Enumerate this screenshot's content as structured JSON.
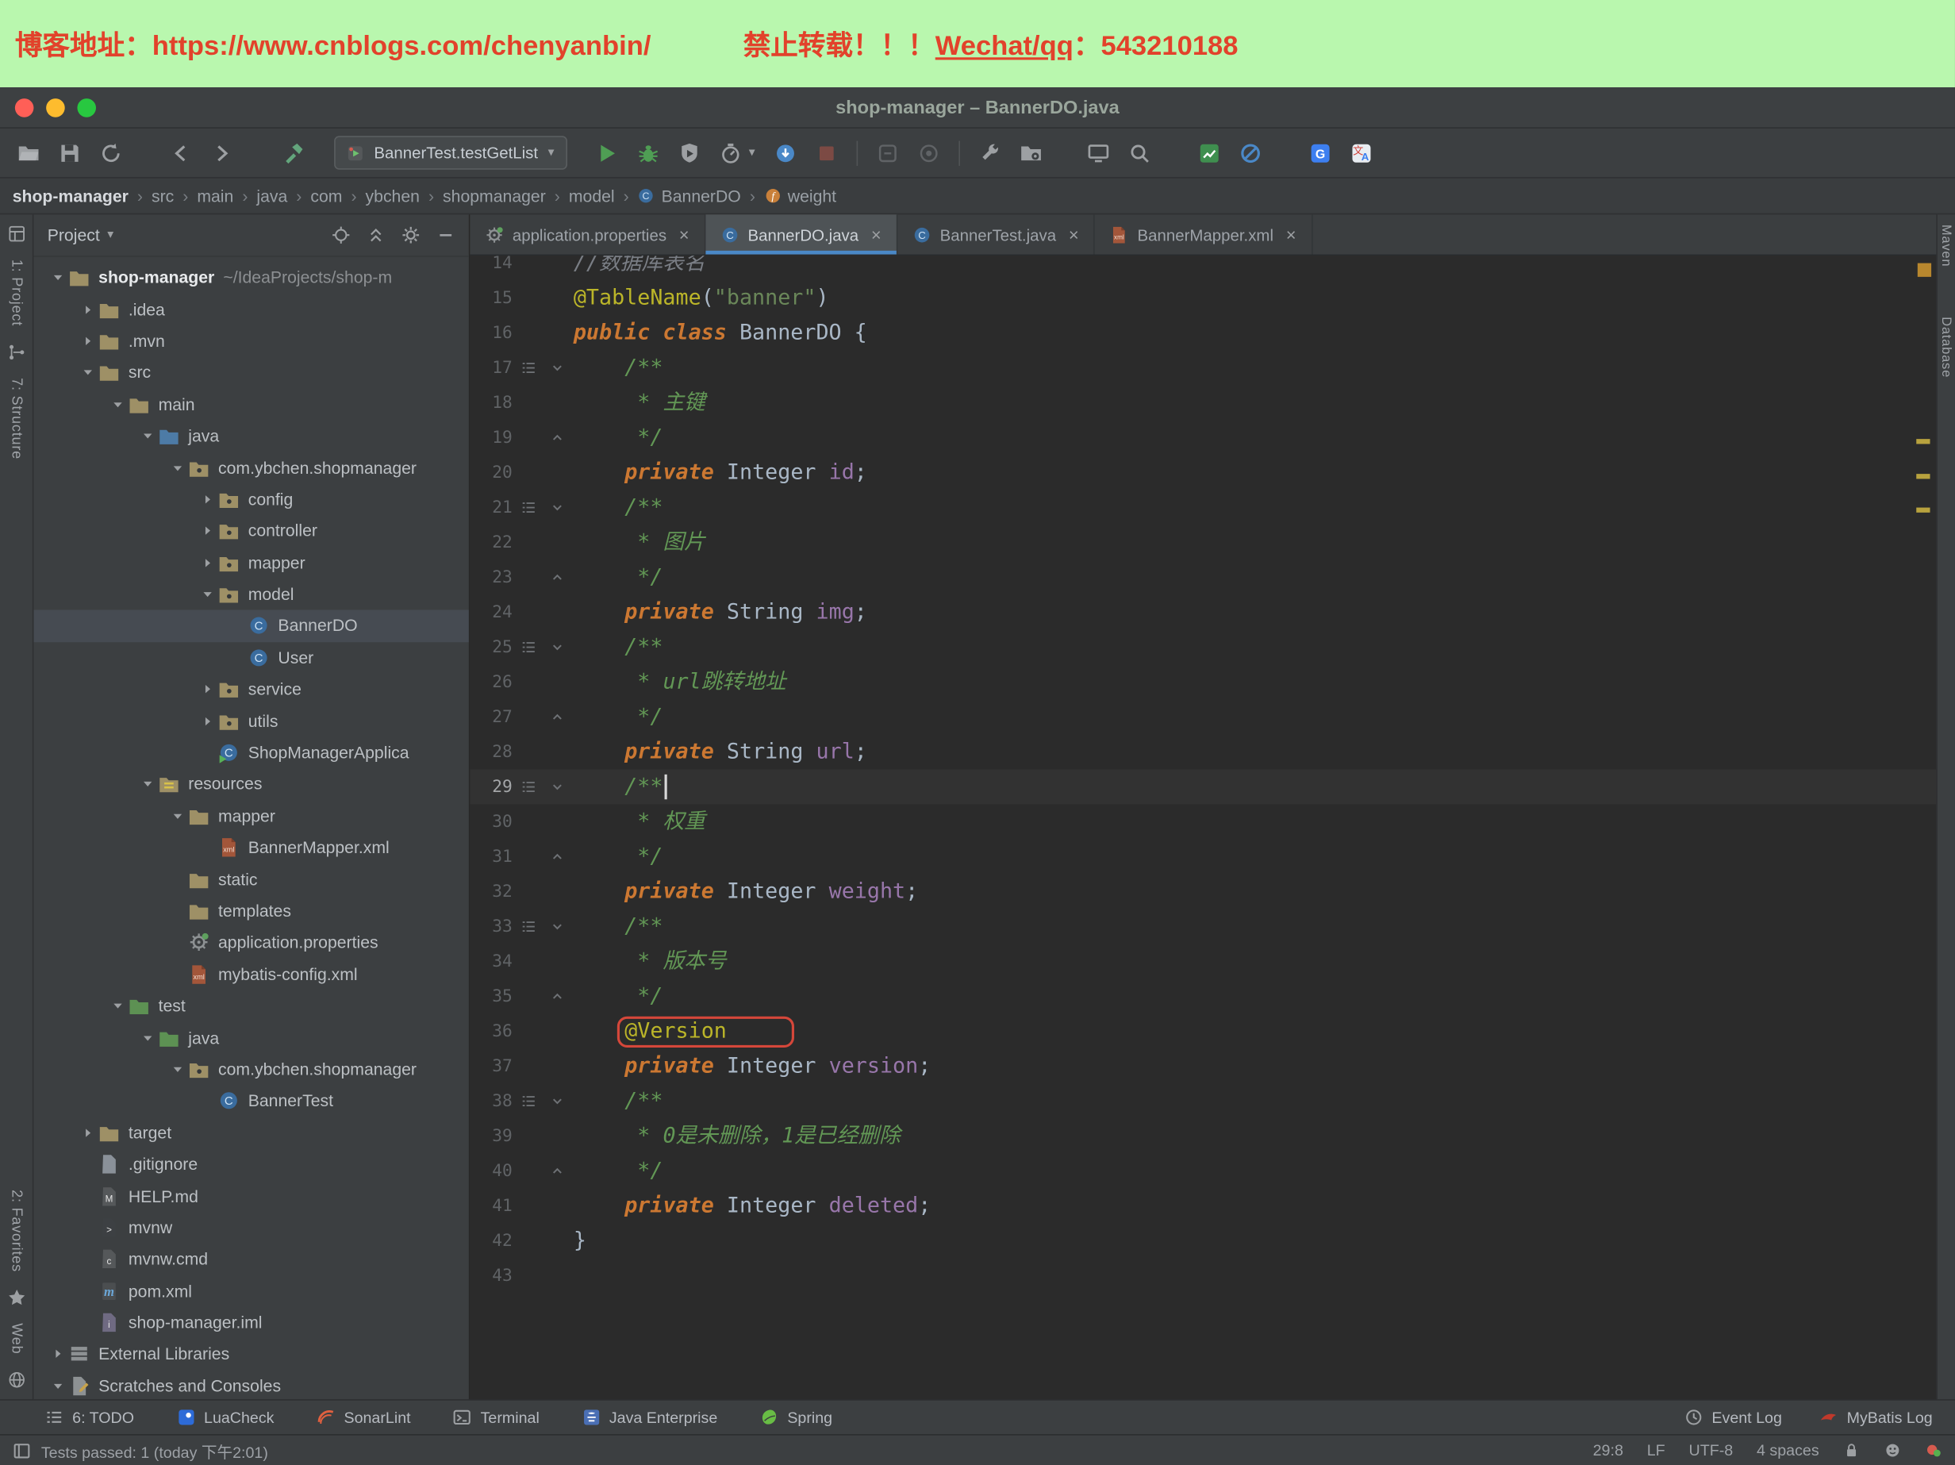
{
  "window": {
    "title": "shop-manager – BannerDO.java"
  },
  "banner": {
    "left": "博客地址：https://www.cnblogs.com/chenyanbin/",
    "right_prefix": "禁止转载！！！",
    "right_link": "Wechat/qq",
    "right_suffix": "：543210188"
  },
  "colors": {
    "banner_bg": "#b9f7ae",
    "banner_text": "#e2422b",
    "accent_blue": "#4a88c7",
    "annotation_highlight_box": "#d5473a",
    "run_green": "#4f9e54",
    "editor_bg": "#2b2b2b",
    "panel_bg": "#3c3f41"
  },
  "toolbar": {
    "run_config": "BannerTest.testGetList",
    "items": [
      {
        "icon": "open-folder-icon"
      },
      {
        "icon": "save-icon"
      },
      {
        "icon": "sync-icon"
      },
      {
        "gap": 8
      },
      {
        "icon": "back-icon"
      },
      {
        "icon": "forward-icon"
      },
      {
        "gap": 10
      },
      {
        "icon": "build-hammer-icon"
      },
      {
        "runconfig": true
      },
      {
        "icon": "run-icon"
      },
      {
        "icon": "debug-icon"
      },
      {
        "icon": "coverage-icon"
      },
      {
        "icon": "profiler-icon",
        "caret": true
      },
      {
        "icon": "attach-icon"
      },
      {
        "icon": "stop-icon"
      },
      {
        "sep": true
      },
      {
        "icon": "attach-debugger-icon"
      },
      {
        "icon": "snapshot-icon"
      },
      {
        "sep": true
      },
      {
        "icon": "wrench-icon"
      },
      {
        "icon": "project-structure-icon"
      },
      {
        "gap": 6
      },
      {
        "icon": "remote-monitor-icon"
      },
      {
        "icon": "search-icon"
      },
      {
        "gap": 8
      },
      {
        "icon": "chart-icon"
      },
      {
        "icon": "blocked-icon"
      },
      {
        "gap": 8
      },
      {
        "icon": "google-translate-icon"
      },
      {
        "icon": "translate-icon"
      }
    ]
  },
  "breadcrumbs": [
    {
      "label": "shop-manager",
      "bold": true
    },
    {
      "label": "src"
    },
    {
      "label": "main"
    },
    {
      "label": "java"
    },
    {
      "label": "com"
    },
    {
      "label": "ybchen"
    },
    {
      "label": "shopmanager"
    },
    {
      "label": "model"
    },
    {
      "label": "BannerDO",
      "icon": "class-icon"
    },
    {
      "label": "weight",
      "icon": "field-icon"
    }
  ],
  "project_panel": {
    "title": "Project",
    "header_icons": [
      "locate-icon",
      "collapse-all-icon",
      "settings-gear-icon",
      "hide-icon"
    ],
    "tree": [
      {
        "label": "shop-manager",
        "suffix": "~/IdeaProjects/shop-m",
        "depth": 0,
        "arrow": "down",
        "icon": "folder",
        "bold": true
      },
      {
        "label": ".idea",
        "depth": 1,
        "arrow": "right",
        "icon": "folder"
      },
      {
        "label": ".mvn",
        "depth": 1,
        "arrow": "right",
        "icon": "folder"
      },
      {
        "label": "src",
        "depth": 1,
        "arrow": "down",
        "icon": "folder"
      },
      {
        "label": "main",
        "depth": 2,
        "arrow": "down",
        "icon": "folder"
      },
      {
        "label": "java",
        "depth": 3,
        "arrow": "down",
        "icon": "folder",
        "color": "#4d7ba6"
      },
      {
        "label": "com.ybchen.shopmanager",
        "depth": 4,
        "arrow": "down",
        "icon": "package"
      },
      {
        "label": "config",
        "depth": 5,
        "arrow": "right",
        "icon": "package"
      },
      {
        "label": "controller",
        "depth": 5,
        "arrow": "right",
        "icon": "package"
      },
      {
        "label": "mapper",
        "depth": 5,
        "arrow": "right",
        "icon": "package"
      },
      {
        "label": "model",
        "depth": 5,
        "arrow": "down",
        "icon": "package"
      },
      {
        "label": "BannerDO",
        "depth": 6,
        "icon": "class",
        "selected": true
      },
      {
        "label": "User",
        "depth": 6,
        "icon": "class"
      },
      {
        "label": "service",
        "depth": 5,
        "arrow": "right",
        "icon": "package"
      },
      {
        "label": "utils",
        "depth": 5,
        "arrow": "right",
        "icon": "package"
      },
      {
        "label": "ShopManagerApplica",
        "depth": 5,
        "icon": "class-run"
      },
      {
        "label": "resources",
        "depth": 3,
        "arrow": "down",
        "icon": "folder-resources"
      },
      {
        "label": "mapper",
        "depth": 4,
        "arrow": "down",
        "icon": "folder"
      },
      {
        "label": "BannerMapper.xml",
        "depth": 5,
        "icon": "xml"
      },
      {
        "label": "static",
        "depth": 4,
        "icon": "folder"
      },
      {
        "label": "templates",
        "depth": 4,
        "icon": "folder"
      },
      {
        "label": "application.properties",
        "depth": 4,
        "icon": "props"
      },
      {
        "label": "mybatis-config.xml",
        "depth": 4,
        "icon": "xml"
      },
      {
        "label": "test",
        "depth": 2,
        "arrow": "down",
        "icon": "folder",
        "color": "#5d9153"
      },
      {
        "label": "java",
        "depth": 3,
        "arrow": "down",
        "icon": "folder",
        "color": "#5d9153"
      },
      {
        "label": "com.ybchen.shopmanager",
        "depth": 4,
        "arrow": "down",
        "icon": "package"
      },
      {
        "label": "BannerTest",
        "depth": 5,
        "icon": "class"
      },
      {
        "label": "target",
        "depth": 1,
        "arrow": "right",
        "icon": "folder"
      },
      {
        "label": ".gitignore",
        "depth": 1,
        "icon": "file",
        "color": "#8a9199"
      },
      {
        "label": "HELP.md",
        "depth": 1,
        "icon": "file",
        "color": "#55585a",
        "letter": "M"
      },
      {
        "label": "mvnw",
        "depth": 1,
        "icon": "file",
        "color": "#3d4043",
        "letter": ">"
      },
      {
        "label": "mvnw.cmd",
        "depth": 1,
        "icon": "file",
        "color": "#55585a",
        "letter": "c"
      },
      {
        "label": "pom.xml",
        "depth": 1,
        "icon": "pom"
      },
      {
        "label": "shop-manager.iml",
        "depth": 1,
        "icon": "file",
        "color": "#6f6a82",
        "letter": "i"
      },
      {
        "label": "External Libraries",
        "depth": 0,
        "arrow": "right",
        "icon": "lib"
      },
      {
        "label": "Scratches and Consoles",
        "depth": 0,
        "arrow": "down",
        "icon": "scratch"
      }
    ]
  },
  "tabs": [
    {
      "label": "application.properties",
      "icon": "props"
    },
    {
      "label": "BannerDO.java",
      "icon": "class",
      "active": true
    },
    {
      "label": "BannerTest.java",
      "icon": "class"
    },
    {
      "label": "BannerMapper.xml",
      "icon": "xml"
    }
  ],
  "editor": {
    "current_line": 29,
    "lines": [
      {
        "n": 14,
        "tk": [
          [
            "lc",
            "//数据库表名"
          ]
        ]
      },
      {
        "n": 15,
        "tk": [
          [
            "a",
            "@TableName"
          ],
          [
            "p",
            "("
          ],
          [
            "s",
            "\"banner\""
          ],
          [
            "p",
            ")"
          ]
        ]
      },
      {
        "n": 16,
        "tk": [
          [
            "k",
            "public class"
          ],
          [
            "p",
            " BannerDO {"
          ]
        ]
      },
      {
        "n": 17,
        "tk": [
          [
            "p",
            "    "
          ],
          [
            "c",
            "/**"
          ]
        ],
        "doc": true
      },
      {
        "n": 18,
        "tk": [
          [
            "p",
            "     "
          ],
          [
            "c",
            "* 主键"
          ]
        ]
      },
      {
        "n": 19,
        "tk": [
          [
            "p",
            "     "
          ],
          [
            "c",
            "*/"
          ]
        ],
        "fe": true
      },
      {
        "n": 20,
        "tk": [
          [
            "p",
            "    "
          ],
          [
            "k",
            "private"
          ],
          [
            "p",
            " "
          ],
          [
            "ty",
            "Integer"
          ],
          [
            "p",
            " "
          ],
          [
            "f",
            "id"
          ],
          [
            "p",
            ";"
          ]
        ]
      },
      {
        "n": 21,
        "tk": [
          [
            "p",
            "    "
          ],
          [
            "c",
            "/**"
          ]
        ],
        "doc": true
      },
      {
        "n": 22,
        "tk": [
          [
            "p",
            "     "
          ],
          [
            "c",
            "* 图片"
          ]
        ]
      },
      {
        "n": 23,
        "tk": [
          [
            "p",
            "     "
          ],
          [
            "c",
            "*/"
          ]
        ],
        "fe": true
      },
      {
        "n": 24,
        "tk": [
          [
            "p",
            "    "
          ],
          [
            "k",
            "private"
          ],
          [
            "p",
            " "
          ],
          [
            "ty",
            "String"
          ],
          [
            "p",
            " "
          ],
          [
            "f",
            "img"
          ],
          [
            "p",
            ";"
          ]
        ]
      },
      {
        "n": 25,
        "tk": [
          [
            "p",
            "    "
          ],
          [
            "c",
            "/**"
          ]
        ],
        "doc": true
      },
      {
        "n": 26,
        "tk": [
          [
            "p",
            "     "
          ],
          [
            "c",
            "* url跳转地址"
          ]
        ]
      },
      {
        "n": 27,
        "tk": [
          [
            "p",
            "     "
          ],
          [
            "c",
            "*/"
          ]
        ],
        "fe": true
      },
      {
        "n": 28,
        "tk": [
          [
            "p",
            "    "
          ],
          [
            "k",
            "private"
          ],
          [
            "p",
            " "
          ],
          [
            "ty",
            "String"
          ],
          [
            "p",
            " "
          ],
          [
            "f",
            "url"
          ],
          [
            "p",
            ";"
          ]
        ]
      },
      {
        "n": 29,
        "tk": [
          [
            "p",
            "    "
          ],
          [
            "c",
            "/**"
          ]
        ],
        "doc": true
      },
      {
        "n": 30,
        "tk": [
          [
            "p",
            "     "
          ],
          [
            "c",
            "* 权重"
          ]
        ]
      },
      {
        "n": 31,
        "tk": [
          [
            "p",
            "     "
          ],
          [
            "c",
            "*/"
          ]
        ],
        "fe": true
      },
      {
        "n": 32,
        "tk": [
          [
            "p",
            "    "
          ],
          [
            "k",
            "private"
          ],
          [
            "p",
            " "
          ],
          [
            "ty",
            "Integer"
          ],
          [
            "p",
            " "
          ],
          [
            "f",
            "weight"
          ],
          [
            "p",
            ";"
          ]
        ]
      },
      {
        "n": 33,
        "tk": [
          [
            "p",
            "    "
          ],
          [
            "c",
            "/**"
          ]
        ],
        "doc": true
      },
      {
        "n": 34,
        "tk": [
          [
            "p",
            "     "
          ],
          [
            "c",
            "* 版本号"
          ]
        ]
      },
      {
        "n": 35,
        "tk": [
          [
            "p",
            "     "
          ],
          [
            "c",
            "*/"
          ]
        ],
        "fe": true
      },
      {
        "n": 36,
        "tk": [
          [
            "p",
            "    "
          ],
          [
            "ab",
            "@Version"
          ]
        ]
      },
      {
        "n": 37,
        "tk": [
          [
            "p",
            "    "
          ],
          [
            "k",
            "private"
          ],
          [
            "p",
            " "
          ],
          [
            "ty",
            "Integer"
          ],
          [
            "p",
            " "
          ],
          [
            "f",
            "version"
          ],
          [
            "p",
            ";"
          ]
        ]
      },
      {
        "n": 38,
        "tk": [
          [
            "p",
            "    "
          ],
          [
            "c",
            "/**"
          ]
        ],
        "doc": true
      },
      {
        "n": 39,
        "tk": [
          [
            "p",
            "     "
          ],
          [
            "c",
            "* 0是未删除，1是已经删除"
          ]
        ]
      },
      {
        "n": 40,
        "tk": [
          [
            "p",
            "     "
          ],
          [
            "c",
            "*/"
          ]
        ],
        "fe": true
      },
      {
        "n": 41,
        "tk": [
          [
            "p",
            "    "
          ],
          [
            "k",
            "private"
          ],
          [
            "p",
            " "
          ],
          [
            "ty",
            "Integer"
          ],
          [
            "p",
            " "
          ],
          [
            "f",
            "deleted"
          ],
          [
            "p",
            ";"
          ]
        ]
      },
      {
        "n": 42,
        "tk": [
          [
            "p",
            "}"
          ]
        ]
      },
      {
        "n": 43,
        "tk": []
      }
    ]
  },
  "status_bar": {
    "left": [
      {
        "label": "6: TODO",
        "icon": "todo-icon"
      },
      {
        "label": "LuaCheck",
        "icon": "lua-icon"
      },
      {
        "label": "SonarLint",
        "icon": "sonar-icon"
      },
      {
        "label": "Terminal",
        "icon": "terminal-icon"
      },
      {
        "label": "Java Enterprise",
        "icon": "javaee-icon"
      },
      {
        "label": "Spring",
        "icon": "spring-icon"
      }
    ],
    "right": [
      {
        "label": "Event Log",
        "icon": "event-log-icon"
      },
      {
        "label": "MyBatis Log",
        "icon": "mybatis-icon"
      }
    ]
  },
  "bottom_bar": {
    "message": "Tests passed: 1 (today 下午2:01)",
    "items": [
      {
        "label": "29:8",
        "name": "caret-position"
      },
      {
        "label": "LF",
        "name": "line-separator"
      },
      {
        "label": "UTF-8",
        "name": "file-encoding"
      },
      {
        "label": "4 spaces",
        "name": "indent-style"
      },
      {
        "icon": "lock-icon"
      },
      {
        "icon": "highlighting-level-icon"
      },
      {
        "icon": "notification-icon"
      }
    ]
  },
  "left_stripe": {
    "top": [
      {
        "icon": "project-tool-icon"
      },
      {
        "label": "1: Project"
      },
      {
        "icon": "structure-tool-icon"
      },
      {
        "label": "7: Structure"
      }
    ],
    "bottom": [
      {
        "label": "2: Favorites"
      },
      {
        "icon": "star-icon"
      },
      {
        "label": "Web"
      },
      {
        "icon": "globe-icon"
      }
    ]
  },
  "right_stripe": {
    "labels": [
      "Maven",
      "Database"
    ]
  }
}
